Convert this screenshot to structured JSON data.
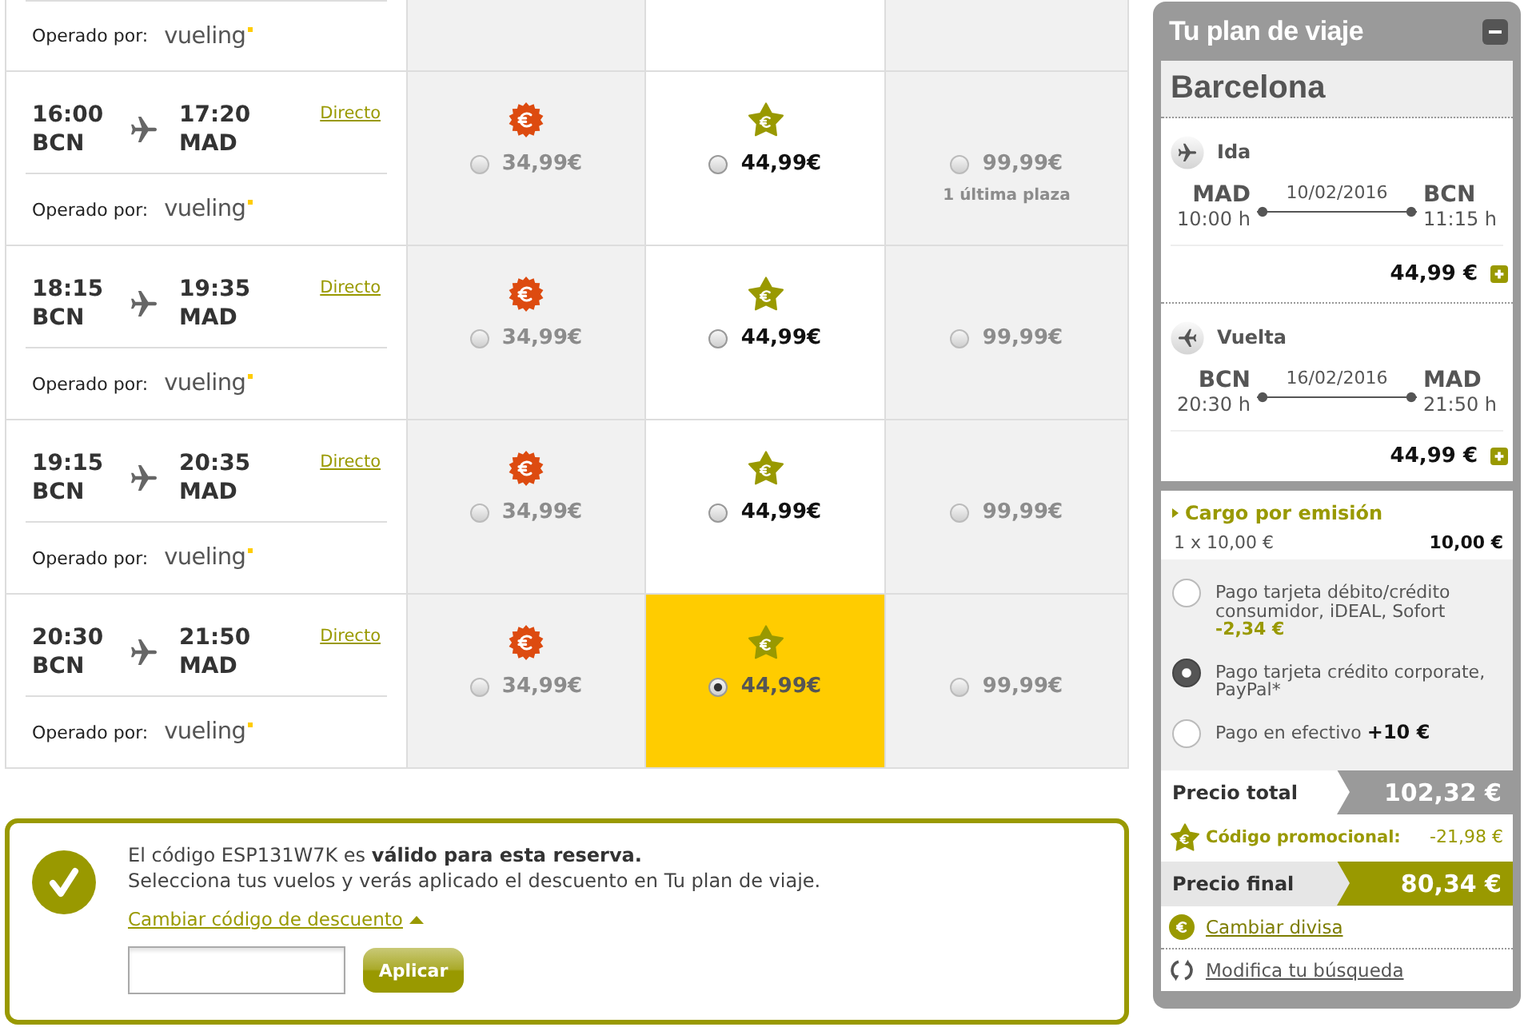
{
  "partial_flight": {
    "operator_label": "Operado por:",
    "operator": "vueling",
    "fares": [
      {
        "disabled": true
      },
      {
        "disabled": false
      },
      {
        "disabled": true
      }
    ]
  },
  "flights": [
    {
      "departure_time": "16:00",
      "departure_airport": "BCN",
      "arrival_time": "17:20",
      "arrival_airport": "MAD",
      "stops": "Directo",
      "operator_label": "Operado por:",
      "operator": "vueling",
      "fares": [
        {
          "kind": "basic",
          "price": "34,99€",
          "disabled": true,
          "selected": false
        },
        {
          "kind": "optima",
          "price": "44,99€",
          "disabled": false,
          "selected": false
        },
        {
          "kind": "flex",
          "price": "99,99€",
          "note": "1 última plaza",
          "disabled": true,
          "selected": false
        }
      ]
    },
    {
      "departure_time": "18:15",
      "departure_airport": "BCN",
      "arrival_time": "19:35",
      "arrival_airport": "MAD",
      "stops": "Directo",
      "operator_label": "Operado por:",
      "operator": "vueling",
      "fares": [
        {
          "kind": "basic",
          "price": "34,99€",
          "disabled": true,
          "selected": false
        },
        {
          "kind": "optima",
          "price": "44,99€",
          "disabled": false,
          "selected": false
        },
        {
          "kind": "flex",
          "price": "99,99€",
          "disabled": true,
          "selected": false
        }
      ]
    },
    {
      "departure_time": "19:15",
      "departure_airport": "BCN",
      "arrival_time": "20:35",
      "arrival_airport": "MAD",
      "stops": "Directo",
      "operator_label": "Operado por:",
      "operator": "vueling",
      "fares": [
        {
          "kind": "basic",
          "price": "34,99€",
          "disabled": true,
          "selected": false
        },
        {
          "kind": "optima",
          "price": "44,99€",
          "disabled": false,
          "selected": false
        },
        {
          "kind": "flex",
          "price": "99,99€",
          "disabled": true,
          "selected": false
        }
      ]
    },
    {
      "departure_time": "20:30",
      "departure_airport": "BCN",
      "arrival_time": "21:50",
      "arrival_airport": "MAD",
      "stops": "Directo",
      "operator_label": "Operado por:",
      "operator": "vueling",
      "fares": [
        {
          "kind": "basic",
          "price": "34,99€",
          "disabled": true,
          "selected": false
        },
        {
          "kind": "optima",
          "price": "44,99€",
          "disabled": false,
          "selected": true
        },
        {
          "kind": "flex",
          "price": "99,99€",
          "disabled": true,
          "selected": false
        }
      ]
    }
  ],
  "promo_box": {
    "message": "El código ESP131W7K es **válido para esta reserva.**",
    "hint": "Selecciona tus vuelos y verás aplicado el descuento en Tu plan de viaje.",
    "toggle_link": "Cambiar código de descuento",
    "expanded": true,
    "button": "Aplicar"
  },
  "plan": {
    "title": "Tu plan de viaje",
    "destination": "Barcelona",
    "legs": [
      {
        "kind": "outbound",
        "label": "Ida",
        "from": "MAD",
        "from_time": "10:00 h",
        "date": "10/02/2016",
        "to": "BCN",
        "to_time": "11:15 h",
        "price": "44,99 €"
      },
      {
        "kind": "return",
        "label": "Vuelta",
        "from": "BCN",
        "from_time": "20:30 h",
        "date": "16/02/2016",
        "to": "MAD",
        "to_time": "21:50 h",
        "price": "44,99 €"
      }
    ],
    "fee": {
      "label": "Cargo por emisión",
      "detail": "1 x 10,00 €",
      "amount": "10,00 €"
    },
    "payment_options": [
      {
        "kind": "discount",
        "label": "Pago tarjeta débito/crédito consumidor, iDEAL, Sofort",
        "adjustment": "-2,34 €",
        "selected": false
      },
      {
        "kind": "plain",
        "label": "Pago tarjeta crédito corporate, PayPal*",
        "selected": true
      },
      {
        "kind": "surcharge",
        "label": "Pago en efectivo",
        "adjustment": "+10 €",
        "selected": false
      }
    ],
    "summary": [
      {
        "kind": "total",
        "label": "Precio total",
        "amount": "102,32 €"
      },
      {
        "kind": "promo",
        "label": "Código promocional:",
        "amount": "-21,98 €"
      },
      {
        "kind": "final",
        "label": "Precio final",
        "amount": "80,34 €"
      }
    ],
    "links": [
      {
        "kind": "currency",
        "label": "Cambiar divisa"
      },
      {
        "kind": "search",
        "label": "Modifica tu búsqueda"
      }
    ]
  }
}
